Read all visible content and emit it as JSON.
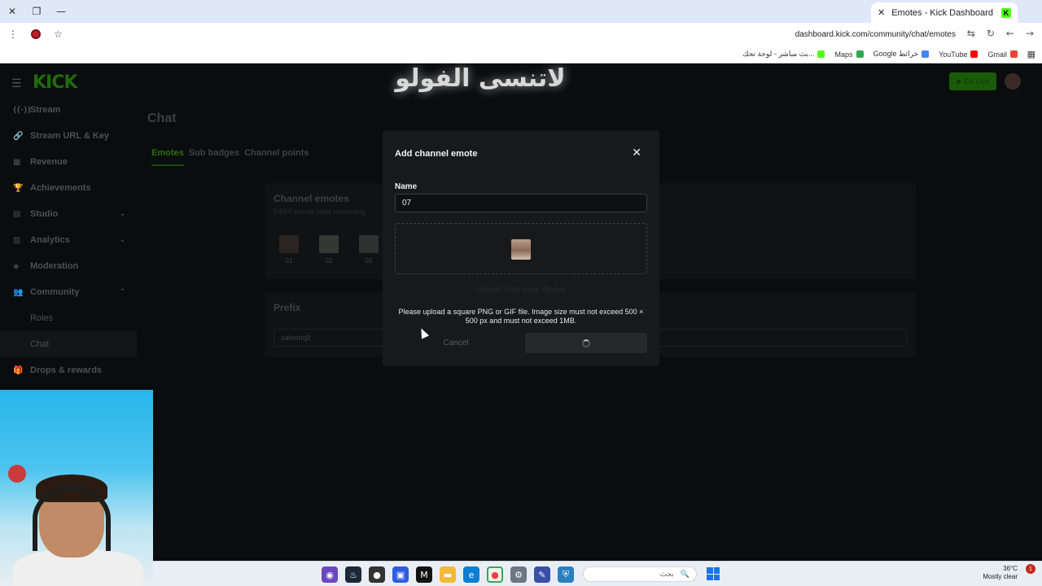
{
  "browser": {
    "tab_title": "Emotes - Kick Dashboard",
    "tab_close": "✕",
    "url": "dashboard.kick.com/community/chat/emotes",
    "bookmarks": [
      {
        "label": "بث مباشر - لوحة تحك...",
        "color": "#53fc18"
      },
      {
        "label": "Maps",
        "color": "#34a853"
      },
      {
        "label": "Google خرائط",
        "color": "#4285f4"
      },
      {
        "label": "YouTube",
        "color": "#ff0000"
      },
      {
        "label": "Gmail",
        "color": "#ea4335"
      }
    ]
  },
  "overlay": {
    "text": "لاتنسى الفولو"
  },
  "header": {
    "logo": "KICK",
    "go_live": "Go Live"
  },
  "sidebar": {
    "items": [
      {
        "label": "Stream",
        "icon": "((·))"
      },
      {
        "label": "Stream URL & Key",
        "icon": "🔗"
      },
      {
        "label": "Revenue",
        "icon": "▦"
      },
      {
        "label": "Achievements",
        "icon": "🏆"
      },
      {
        "label": "Studio",
        "icon": "▤",
        "chevron": "⌄"
      },
      {
        "label": "Analytics",
        "icon": "▥",
        "chevron": "⌄"
      },
      {
        "label": "Moderation",
        "icon": "◈"
      },
      {
        "label": "Community",
        "icon": "👥",
        "chevron": "⌃"
      }
    ],
    "sub_items": [
      {
        "label": "Roles"
      },
      {
        "label": "Chat"
      }
    ],
    "bottom_item": {
      "label": "Drops & rewards",
      "icon": "🎁"
    }
  },
  "main": {
    "title": "Chat",
    "tabs": [
      "Emotes",
      "Sub badges",
      "Channel points"
    ],
    "channel_emotes": {
      "title": "Channel emotes",
      "subtitle": "54/60 emote slots remaining",
      "emotes": [
        "01",
        "02",
        "03"
      ]
    },
    "prefix": {
      "title": "Prefix",
      "value": "saloohq8"
    }
  },
  "modal": {
    "title": "Add channel emote",
    "name_label": "Name",
    "name_value": "07",
    "upload_link": "Upload from local device",
    "help_text": "Please upload a square PNG or GIF file. Image size must not exceed 500 × 500 px and must not exceed 1MB.",
    "cancel": "Cancel"
  },
  "taskbar": {
    "search_placeholder": "بحث",
    "weather_temp": "36°C",
    "weather_desc": "Mostly clear",
    "notifications": "1"
  }
}
